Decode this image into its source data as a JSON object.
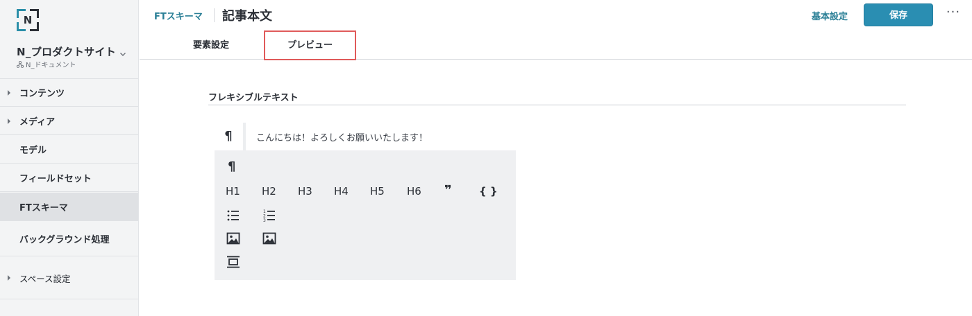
{
  "sidebar": {
    "logo_letter": "N",
    "space": {
      "name": "N_プロダクトサイト",
      "sub": "N_ドキュメント"
    },
    "items": [
      {
        "label": "コンテンツ"
      },
      {
        "label": "メディア"
      },
      {
        "label": "モデル"
      },
      {
        "label": "フィールドセット"
      },
      {
        "label": "FTスキーマ"
      },
      {
        "label": "バックグラウンド処理"
      },
      {
        "label": "スペース設定"
      }
    ]
  },
  "header": {
    "breadcrumb": "FTスキーマ",
    "title": "記事本文",
    "basic_settings": "基本設定",
    "save": "保存",
    "more": "···"
  },
  "tabs": [
    {
      "label": "要素設定"
    },
    {
      "label": "プレビュー"
    }
  ],
  "editor": {
    "section_title": "フレキシブルテキスト",
    "paragraph_mark": "¶",
    "paragraph_text": "こんにちは！よろしくお願いいたします！",
    "block_menu": {
      "paragraph": "¶",
      "headings": [
        "H1",
        "H2",
        "H3",
        "H4",
        "H5",
        "H6"
      ],
      "quote": "❞",
      "code": "{ }"
    }
  },
  "colors": {
    "accent": "#2a8eb2",
    "link": "#2a7f96",
    "highlight_border": "#e05a5a",
    "sidebar_bg": "#f3f4f5",
    "menu_bg": "#eff0f2"
  }
}
